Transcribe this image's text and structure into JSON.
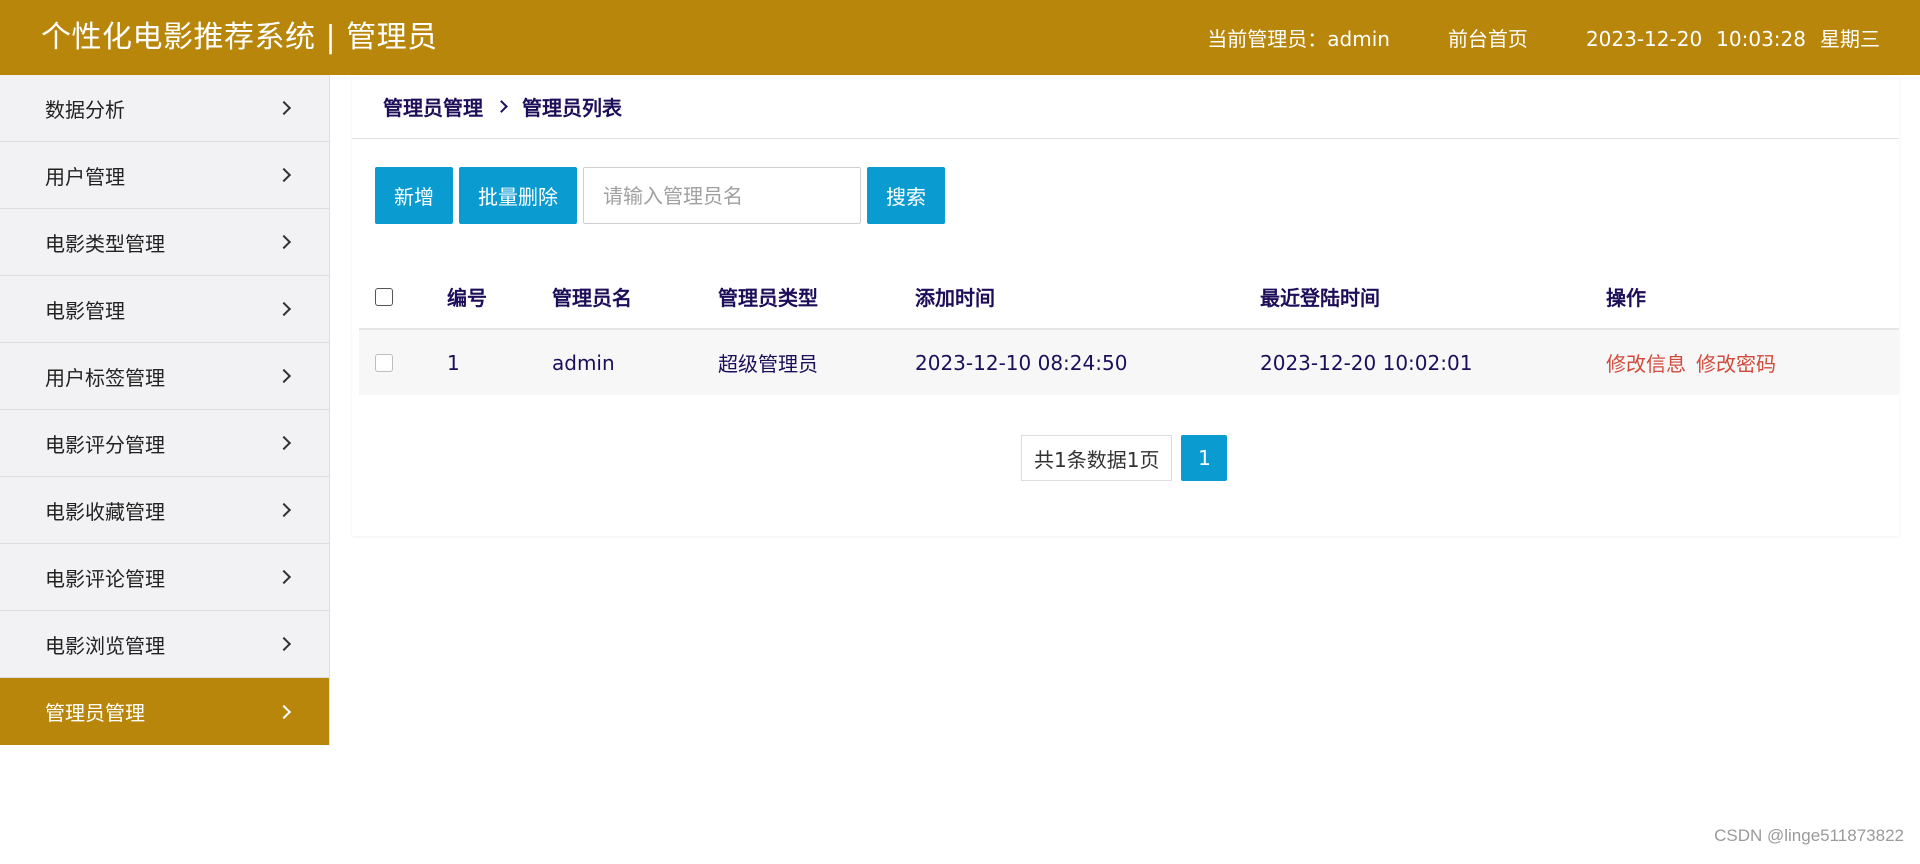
{
  "header": {
    "title": "个性化电影推荐系统 | 管理员",
    "current_admin": "当前管理员：admin",
    "home_link": "前台首页",
    "date": "2023-12-20",
    "time": "10:03:28",
    "weekday": "星期三",
    "color": "#b8860b"
  },
  "sidebar": {
    "items": [
      {
        "label": "数据分析"
      },
      {
        "label": "用户管理"
      },
      {
        "label": "电影类型管理"
      },
      {
        "label": "电影管理"
      },
      {
        "label": "用户标签管理"
      },
      {
        "label": "电影评分管理"
      },
      {
        "label": "电影收藏管理"
      },
      {
        "label": "电影评论管理"
      },
      {
        "label": "电影浏览管理"
      },
      {
        "label": "管理员管理"
      }
    ],
    "active_index": 9
  },
  "breadcrumb": {
    "parent": "管理员管理",
    "current": "管理员列表"
  },
  "toolbar": {
    "add_label": "新增",
    "batch_delete_label": "批量删除",
    "search_placeholder": "请输入管理员名",
    "search_value": "",
    "search_label": "搜索",
    "button_color": "#0a9bd0"
  },
  "table": {
    "headers": {
      "id": "编号",
      "name": "管理员名",
      "type": "管理员类型",
      "added": "添加时间",
      "last_login": "最近登陆时间",
      "actions": "操作"
    },
    "rows": [
      {
        "id": "1",
        "name": "admin",
        "type": "超级管理员",
        "added": "2023-12-10 08:24:50",
        "last_login": "2023-12-20 10:02:01",
        "edit_info": "修改信息",
        "edit_password": "修改密码"
      }
    ]
  },
  "pagination": {
    "summary": "共1条数据1页",
    "current_page": "1"
  },
  "watermark": "CSDN @linge511873822"
}
